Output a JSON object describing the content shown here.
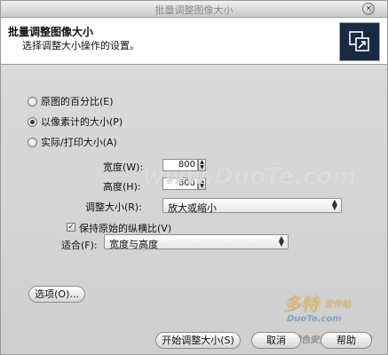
{
  "window": {
    "title": "批量调整图像大小",
    "close_glyph": "×"
  },
  "header": {
    "title": "批量调整图像大小",
    "subtitle": "选择调整大小操作的设置。",
    "icon": "resize-image-icon"
  },
  "options": {
    "percent_label": "原图的百分比(E)",
    "pixel_label": "以像素计的大小(P)",
    "print_label": "实际/打印大小(A)",
    "selected": "pixel"
  },
  "size": {
    "width_label": "宽度(W):",
    "width_value": "800",
    "height_label": "高度(H):",
    "height_value": "600",
    "adjust_label": "调整大小(R):",
    "adjust_value": "放大或缩小"
  },
  "aspect": {
    "label": "保持原始的纵横比(V)",
    "checked": true
  },
  "fit": {
    "label": "适合(F):",
    "value": "宽度与高度"
  },
  "buttons": {
    "options": "选项(O)...",
    "start": "开始调整大小(S)",
    "cancel": "取消",
    "help": "帮助"
  },
  "watermark": {
    "main": "www.DuoTe.com",
    "brand": "多特",
    "brand_sub": "软件站",
    "brand_url": "DuoTe.com",
    "bottom": "绿色安全更新软件站"
  }
}
